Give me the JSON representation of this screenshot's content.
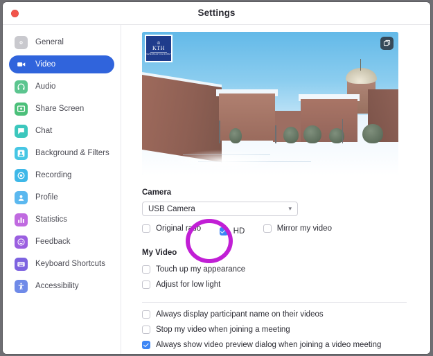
{
  "window": {
    "title": "Settings",
    "close_label": "Close"
  },
  "sidebar": {
    "items": [
      {
        "label": "General",
        "icon": "gear-icon",
        "color": "#c9c9ce",
        "active": false
      },
      {
        "label": "Video",
        "icon": "video-camera-icon",
        "color": "#3064dc",
        "active": true
      },
      {
        "label": "Audio",
        "icon": "headphones-icon",
        "color": "#5cc58f",
        "active": false
      },
      {
        "label": "Share Screen",
        "icon": "share-screen-icon",
        "color": "#4cc07a",
        "active": false
      },
      {
        "label": "Chat",
        "icon": "chat-bubble-icon",
        "color": "#3cc7bd",
        "active": false
      },
      {
        "label": "Background & Filters",
        "icon": "person-frame-icon",
        "color": "#47c6e4",
        "active": false
      },
      {
        "label": "Recording",
        "icon": "record-circle-icon",
        "color": "#3eb8e8",
        "active": false
      },
      {
        "label": "Profile",
        "icon": "person-icon",
        "color": "#5bb8ef",
        "active": false
      },
      {
        "label": "Statistics",
        "icon": "bar-chart-icon",
        "color": "#c06ae0",
        "active": false
      },
      {
        "label": "Feedback",
        "icon": "smiley-icon",
        "color": "#9b5fe0",
        "active": false
      },
      {
        "label": "Keyboard Shortcuts",
        "icon": "keyboard-icon",
        "color": "#7d63e0",
        "active": false
      },
      {
        "label": "Accessibility",
        "icon": "accessibility-icon",
        "color": "#6f8ae8",
        "active": false
      }
    ]
  },
  "preview": {
    "overlay_logo": "kth-logo",
    "logo_text": "KTH",
    "logo_subtext": "VETENSKAP OCH KONST",
    "pip_button": "picture-in-picture-button",
    "scene_description": "Snow-covered campus courtyard with red brick buildings and blue sky"
  },
  "camera": {
    "heading": "Camera",
    "selected_device": "USB Camera",
    "options": [
      "USB Camera"
    ],
    "checkboxes": [
      {
        "label": "Original ratio",
        "checked": false
      },
      {
        "label": "HD",
        "checked": true
      },
      {
        "label": "Mirror my video",
        "checked": false
      }
    ]
  },
  "my_video": {
    "heading": "My Video",
    "checkboxes": [
      {
        "label": "Touch up my appearance",
        "checked": false
      },
      {
        "label": "Adjust for low light",
        "checked": false
      }
    ]
  },
  "meetings": {
    "checkboxes": [
      {
        "label": "Always display participant name on their videos",
        "checked": false
      },
      {
        "label": "Stop my video when joining a meeting",
        "checked": false
      },
      {
        "label": "Always show video preview dialog when joining a video meeting",
        "checked": true
      }
    ]
  },
  "annotation": {
    "shape": "circle-highlight",
    "target": "HD checkbox",
    "color": "#c11fd5"
  }
}
